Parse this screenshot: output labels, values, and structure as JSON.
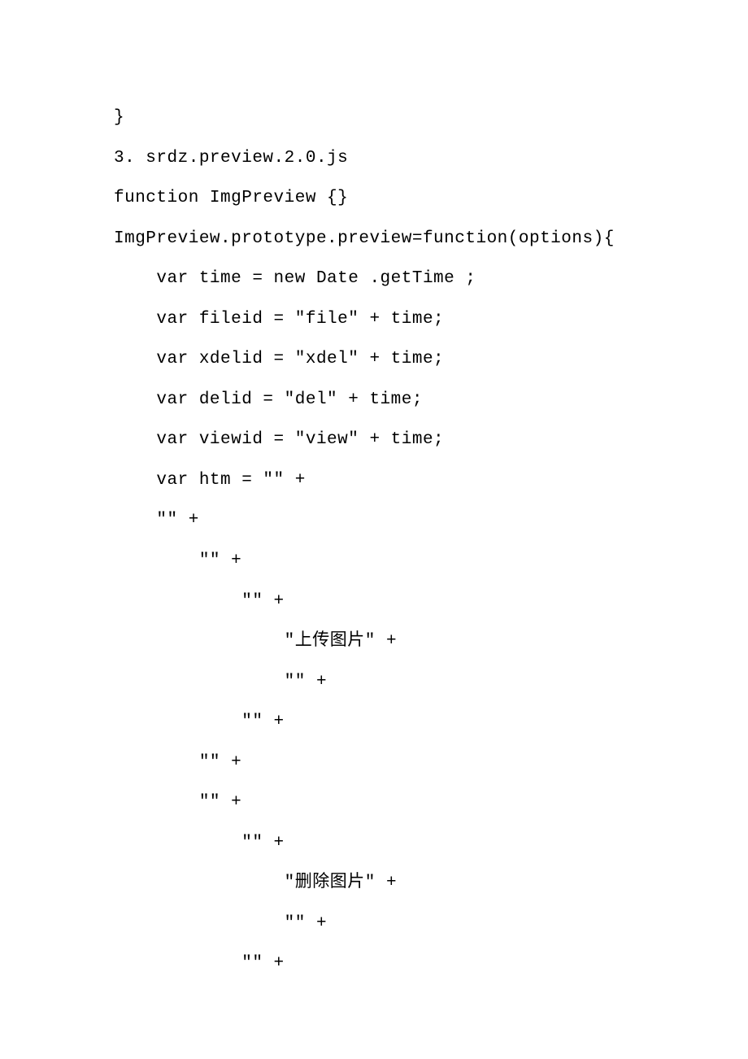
{
  "lines": [
    {
      "indent": 0,
      "text": "}"
    },
    {
      "indent": 0,
      "text": "3. srdz.preview.2.0.js"
    },
    {
      "indent": 0,
      "text": "function ImgPreview {}"
    },
    {
      "indent": 0,
      "text": "ImgPreview.prototype.preview=function(options){"
    },
    {
      "indent": 1,
      "text": "var time = new Date .getTime ;"
    },
    {
      "indent": 1,
      "text": "var fileid = \"file\" + time;"
    },
    {
      "indent": 1,
      "text": "var xdelid = \"xdel\" + time;"
    },
    {
      "indent": 1,
      "text": "var delid = \"del\" + time;"
    },
    {
      "indent": 1,
      "text": "var viewid = \"view\" + time;"
    },
    {
      "indent": 1,
      "text": "var htm = \"\" +"
    },
    {
      "indent": 1,
      "text": "\"\" +"
    },
    {
      "indent": 2,
      "text": "\"\" +"
    },
    {
      "indent": 3,
      "text": "\"\" +"
    },
    {
      "indent": 4,
      "text": "\"上传图片\" +"
    },
    {
      "indent": 4,
      "text": "\"\" +"
    },
    {
      "indent": 3,
      "text": "\"\" +"
    },
    {
      "indent": 2,
      "text": "\"\" +"
    },
    {
      "indent": 2,
      "text": "\"\" +"
    },
    {
      "indent": 3,
      "text": "\"\" +"
    },
    {
      "indent": 4,
      "text": "\"删除图片\" +"
    },
    {
      "indent": 4,
      "text": "\"\" +"
    },
    {
      "indent": 3,
      "text": "\"\" +"
    }
  ],
  "indentUnit": "    "
}
